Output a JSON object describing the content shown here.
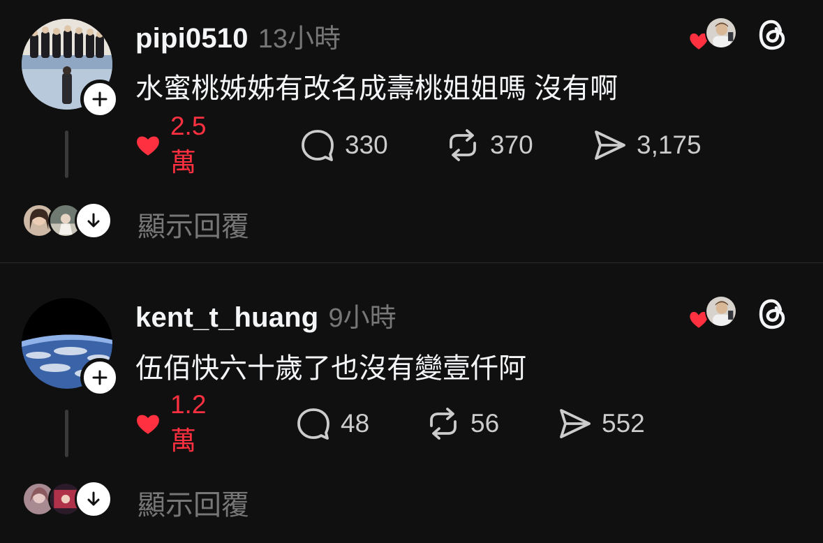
{
  "colors": {
    "background": "#101010",
    "text_primary": "#f3f5f7",
    "text_secondary": "#777777",
    "like_red": "#ff3040"
  },
  "posts": [
    {
      "username": "pipi0510",
      "time": "13小時",
      "text": "水蜜桃姊姊有改名成壽桃姐姐嗎 沒有啊",
      "likes": "2.5萬",
      "comments": "330",
      "reposts": "370",
      "shares": "3,175",
      "show_replies": "顯示回覆",
      "liked": true
    },
    {
      "username": "kent_t_huang",
      "time": "9小時",
      "text": "伍佰快六十歲了也沒有變壹仟阿",
      "likes": "1.2萬",
      "comments": "48",
      "reposts": "56",
      "shares": "552",
      "show_replies": "顯示回覆",
      "liked": true
    }
  ],
  "icons": {
    "like": "heart-icon",
    "comment": "comment-bubble-icon",
    "repost": "repost-icon",
    "share": "share-send-icon",
    "app": "threads-logo-icon",
    "follow": "plus-icon",
    "expand": "arrow-down-icon"
  }
}
